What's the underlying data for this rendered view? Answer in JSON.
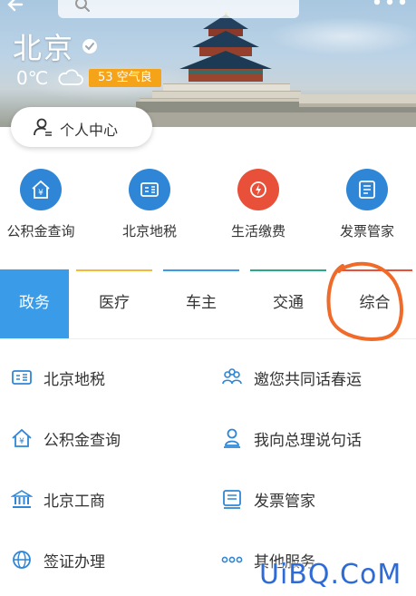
{
  "header": {
    "city": "北京",
    "temperature": "0℃",
    "air_quality": "53 空气良",
    "personal_center": "个人中心"
  },
  "quick_services": [
    {
      "label": "公积金查询",
      "icon": "house-icon",
      "color": "#2f86d6"
    },
    {
      "label": "北京地税",
      "icon": "tax-icon",
      "color": "#2f86d6"
    },
    {
      "label": "生活缴费",
      "icon": "bolt-icon",
      "color": "#e8503a"
    },
    {
      "label": "发票管家",
      "icon": "invoice-icon",
      "color": "#2f86d6"
    }
  ],
  "tabs": [
    {
      "label": "政务",
      "active": true,
      "color": "#3a9ce8"
    },
    {
      "label": "医疗",
      "active": false,
      "color": "#f5b93a"
    },
    {
      "label": "车主",
      "active": false,
      "color": "#3a9ce8"
    },
    {
      "label": "交通",
      "active": false,
      "color": "#27a98a"
    },
    {
      "label": "综合",
      "active": false,
      "color": "#e8503a"
    }
  ],
  "services": [
    {
      "label": "北京地税",
      "icon": "tax-icon"
    },
    {
      "label": "邀您共同话春运",
      "icon": "group-icon"
    },
    {
      "label": "公积金查询",
      "icon": "house-icon"
    },
    {
      "label": "我向总理说句话",
      "icon": "person-stand-icon"
    },
    {
      "label": "北京工商",
      "icon": "bank-icon"
    },
    {
      "label": "发票管家",
      "icon": "invoice-icon"
    },
    {
      "label": "签证办理",
      "icon": "globe-icon"
    },
    {
      "label": "其他服务",
      "icon": "more-dots-icon"
    }
  ],
  "watermark": "UiBQ.CoM",
  "colors": {
    "accent": "#3a9ce8",
    "icon_blue": "#2f86d6",
    "aqi": "#f5a41a",
    "annotation": "#f06a2a"
  }
}
